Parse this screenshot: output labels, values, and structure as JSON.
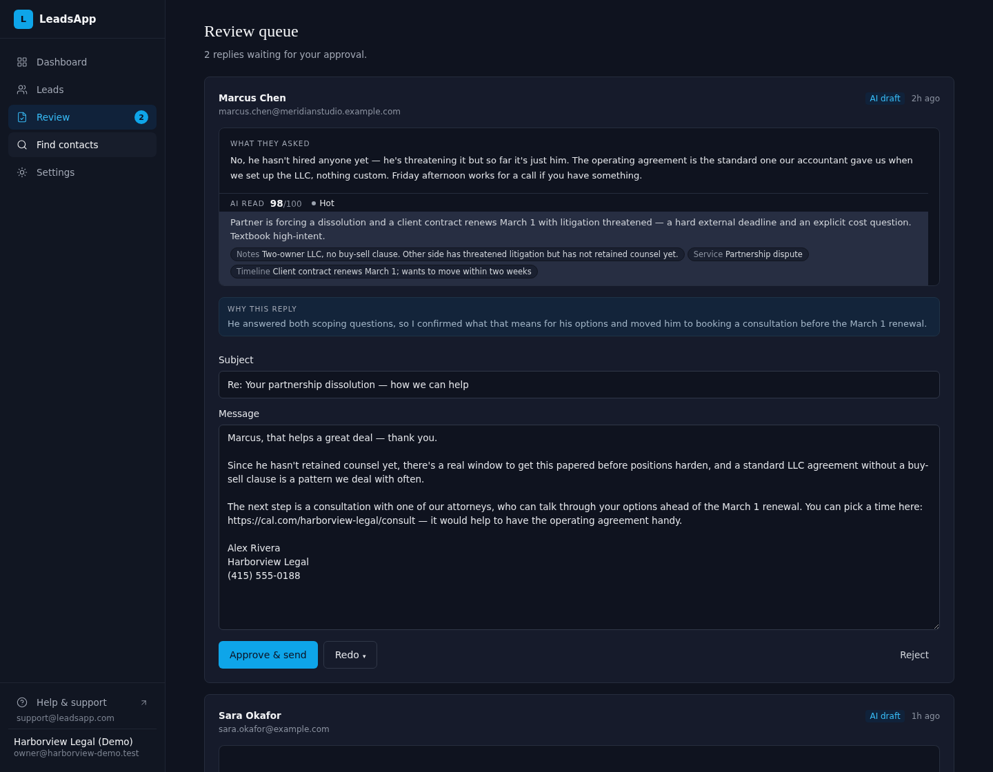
{
  "app": {
    "logo_letter": "L",
    "name": "LeadsApp"
  },
  "sidebar": {
    "items": [
      {
        "label": "Dashboard",
        "kind": "dashboard",
        "selected": false,
        "hovered": false
      },
      {
        "label": "Leads",
        "kind": "leads",
        "selected": false,
        "hovered": false
      },
      {
        "label": "Review",
        "kind": "review",
        "selected": true,
        "hovered": false,
        "badge": "2"
      },
      {
        "label": "Find contacts",
        "kind": "search",
        "selected": false,
        "hovered": true
      },
      {
        "label": "Settings",
        "kind": "settings",
        "selected": false,
        "hovered": false
      }
    ],
    "help": {
      "label": "Help & support",
      "email": "support@leadsapp.com"
    },
    "account": {
      "name": "Harborview Legal (Demo)",
      "email": "owner@harborview-demo.test"
    }
  },
  "page": {
    "title": "Review queue",
    "subtitle": "2 replies waiting for your approval."
  },
  "cards": [
    {
      "name": "Marcus Chen",
      "email": "marcus.chen@meridianstudio.example.com",
      "badge": "AI draft",
      "time": "2h ago",
      "asked": {
        "label": "WHAT THEY ASKED",
        "text": "No, he hasn't hired anyone yet — he's threatening it but so far it's just him. The operating agreement is the standard one our accountant gave us when we set up the LLC, nothing custom. Friday afternoon works for a call if you have something."
      },
      "ai_read": {
        "label": "AI READ",
        "score": "98",
        "max": "/100",
        "temperature": "Hot",
        "summary": "Partner is forcing a dissolution and a client contract renews March 1 with litigation threatened — a hard external deadline and an explicit cost question. Textbook high-intent.",
        "tags": [
          {
            "key": "Notes",
            "value": "Two-owner LLC, no buy-sell clause. Other side has threatened litigation but has not retained counsel yet."
          },
          {
            "key": "Service",
            "value": "Partnership dispute"
          },
          {
            "key": "Timeline",
            "value": "Client contract renews March 1; wants to move within two weeks"
          }
        ]
      },
      "why": {
        "label": "WHY THIS REPLY",
        "text": "He answered both scoping questions, so I confirmed what that means for his options and moved him to booking a consultation before the March 1 renewal."
      },
      "subject": {
        "label": "Subject",
        "value": "Re: Your partnership dissolution — how we can help"
      },
      "message": {
        "label": "Message",
        "value": "Marcus, that helps a great deal — thank you.\n\nSince he hasn't retained counsel yet, there's a real window to get this papered before positions harden, and a standard LLC agreement without a buy-sell clause is a pattern we deal with often.\n\nThe next step is a consultation with one of our attorneys, who can talk through your options ahead of the March 1 renewal. You can pick a time here: https://cal.com/harborview-legal/consult — it would help to have the operating agreement handy.\n\nAlex Rivera\nHarborview Legal\n(415) 555-0188"
      },
      "actions": {
        "approve": "Approve & send",
        "redo": "Redo",
        "redo_caret": "▾",
        "reject": "Reject"
      }
    },
    {
      "name": "Sara Okafor",
      "email": "sara.okafor@example.com",
      "badge": "AI draft",
      "time": "1h ago"
    }
  ]
}
